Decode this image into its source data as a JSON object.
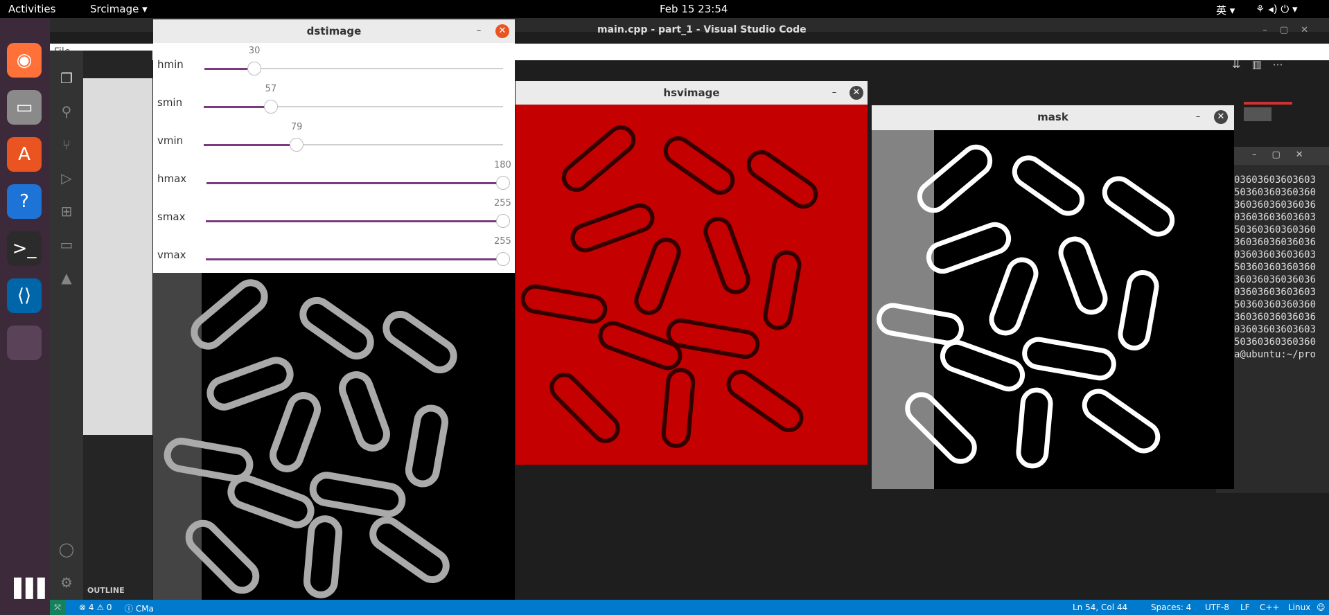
{
  "topbar": {
    "activities": "Activities",
    "app": "Srcimage ▾",
    "clock": "Feb 15  23:54",
    "ime": "英 ▾",
    "sys_icons": "⚘ ◂) ⏻ ▾"
  },
  "dock": {
    "items": [
      {
        "name": "firefox-icon",
        "glyph": "◉",
        "color": "#ff7139"
      },
      {
        "name": "files-icon",
        "glyph": "▭",
        "color": "#8a8a8a"
      },
      {
        "name": "software-icon",
        "glyph": "A",
        "color": "#e95420"
      },
      {
        "name": "help-icon",
        "glyph": "?",
        "color": "#1e73d6"
      },
      {
        "name": "terminal-icon",
        "glyph": ">_",
        "color": "#2b2b2b"
      },
      {
        "name": "vscode-icon",
        "glyph": "⟨⟩",
        "color": "#0065a9"
      },
      {
        "name": "running-app-icon",
        "glyph": "",
        "color": "#5a4358"
      }
    ],
    "apps_grid": "⋮⋮⋮"
  },
  "vscode": {
    "title": "main.cpp - part_1 - Visual Studio Code",
    "menu_file": "File",
    "outline": "OUTLINE",
    "status": {
      "errors": "⊗ 4 ⚠ 0",
      "cmake": "ⓘ CMa",
      "position": "Ln 54, Col 44",
      "spaces": "Spaces: 4",
      "encoding": "UTF-8",
      "eol": "LF",
      "lang": "C++",
      "platform": "Linux"
    }
  },
  "dstimage": {
    "title": "dstimage",
    "sliders": [
      {
        "label": "hmin",
        "value": 30,
        "max": 180
      },
      {
        "label": "smin",
        "value": 57,
        "max": 255
      },
      {
        "label": "vmin",
        "value": 79,
        "max": 255
      },
      {
        "label": "hmax",
        "value": 180,
        "max": 180
      },
      {
        "label": "smax",
        "value": 255,
        "max": 255
      },
      {
        "label": "vmax",
        "value": 255,
        "max": 255
      }
    ]
  },
  "hsvimage": {
    "title": "hsvimage"
  },
  "mask": {
    "title": "mask"
  },
  "terminal": {
    "lines": [
      "03603603603603",
      "50360360360360",
      "36036036036036",
      "03603603603603",
      "50360360360360",
      "36036036036036",
      "03603603603603",
      "50360360360360",
      "36036036036036",
      "03603603603603",
      "50360360360360",
      "36036036036036",
      "03603603603603",
      "50360360360360",
      "a@ubuntu:~/pro"
    ]
  },
  "colors": {
    "accent": "#7a3a7d",
    "red_image": "#c40000",
    "status_blue": "#007acc",
    "dock_bg": "#3c2a3a"
  }
}
